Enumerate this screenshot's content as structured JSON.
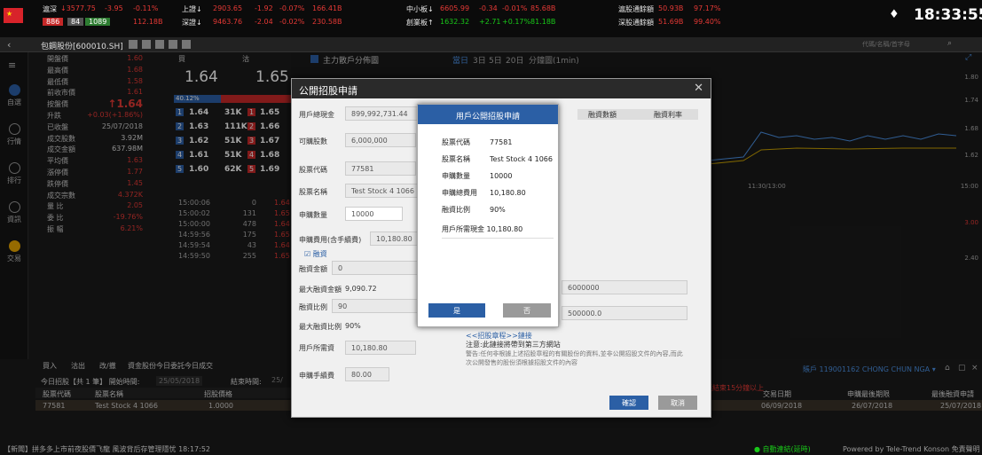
{
  "topbar": {
    "sz_name": "滬深",
    "sz_value": "↓3577.75",
    "sz_chg": "-3.95",
    "sz_pct": "-0.11%",
    "sz_up": "886",
    "sz_flat": "84",
    "sz_down": "1089",
    "sz_amt": "112.18B",
    "sh_name": "上證↓",
    "sh_value": "2903.65",
    "sh_chg": "-1.92",
    "sh_pct": "-0.07%",
    "sh_amt": "166.41B",
    "szc_name": "深證↓",
    "szc_value": "9463.76",
    "szc_chg": "-2.04",
    "szc_pct": "-0.02%",
    "szc_amt": "230.58B",
    "sme_name": "中小板↓",
    "sme_value": "6605.99",
    "sme_chg": "-0.34",
    "sme_pct": "-0.01%",
    "sme_amt": "85.68B",
    "gem_name": "創業板↑",
    "gem_value": "1632.32",
    "gem_chg": "+2.71",
    "gem_pct": "+0.17%",
    "gem_amt": "81.18B",
    "hk_sh_name": "滬股通餘額",
    "hk_sh_value": "50.93B",
    "hk_sh_pct": "97.17%",
    "hk_sz_name": "深股通餘額",
    "hk_sz_value": "51.69B",
    "hk_sz_pct": "99.40%",
    "time": "18:33:55"
  },
  "nav2": {
    "stock": "包鋼股份[600010.SH]",
    "search_placeholder": "代碼/名稱/首字母"
  },
  "leftnav": [
    {
      "label": "自選"
    },
    {
      "label": "行情"
    },
    {
      "label": "排行"
    },
    {
      "label": "資訊"
    },
    {
      "label": "交易"
    }
  ],
  "quote": {
    "rows": [
      {
        "label": "開盤價",
        "value": "1.60"
      },
      {
        "label": "最高價",
        "value": "1.68"
      },
      {
        "label": "最低價",
        "value": "1.58"
      },
      {
        "label": "前收市價",
        "value": "1.61"
      },
      {
        "label": "按盤價",
        "value": "↑1.64"
      },
      {
        "label": "升跌",
        "value": "+0.03(+1.86%)"
      },
      {
        "label": "已收盤",
        "value": "25/07/2018"
      },
      {
        "label": "成交股數",
        "value": "3.92M"
      },
      {
        "label": "成交金額",
        "value": "637.98M"
      },
      {
        "label": "平均價",
        "value": "1.63"
      },
      {
        "label": "漲停價",
        "value": "1.77"
      },
      {
        "label": "跌停價",
        "value": "1.45"
      },
      {
        "label": "成交宗數",
        "value": "4.372K"
      },
      {
        "label": "量 比",
        "value": "2.05"
      },
      {
        "label": "委 比",
        "value": "-19.76%"
      },
      {
        "label": "振 幅",
        "value": "6.21%"
      }
    ],
    "buy_label": "買",
    "sell_label": "沽",
    "buy_price": "1.64",
    "sell_price": "1.65",
    "buy_pct": "40.12%",
    "book": [
      {
        "n": "1",
        "bp": "1.64",
        "bv": "31K",
        "sn": "1",
        "sp": "1.65"
      },
      {
        "n": "2",
        "bp": "1.63",
        "bv": "111K",
        "sn": "2",
        "sp": "1.66"
      },
      {
        "n": "3",
        "bp": "1.62",
        "bv": "51K",
        "sn": "3",
        "sp": "1.67"
      },
      {
        "n": "4",
        "bp": "1.61",
        "bv": "51K",
        "sn": "4",
        "sp": "1.68"
      },
      {
        "n": "5",
        "bp": "1.60",
        "bv": "62K",
        "sn": "5",
        "sp": "1.69"
      }
    ],
    "ticks": [
      {
        "t": "15:00:06",
        "v": "0",
        "p": "1.64"
      },
      {
        "t": "15:00:02",
        "v": "131",
        "p": "1.65"
      },
      {
        "t": "15:00:00",
        "v": "478",
        "p": "1.64"
      },
      {
        "t": "14:59:56",
        "v": "175",
        "p": "1.65"
      },
      {
        "t": "14:59:54",
        "v": "43",
        "p": "1.64"
      },
      {
        "t": "14:59:50",
        "v": "255",
        "p": "1.65"
      }
    ]
  },
  "chart": {
    "tab1": "主力散戶分佈圖",
    "tab2": "當日",
    "tab3": "3日",
    "tab4": "5日",
    "tab5": "20日",
    "tab6": "分鐘圖(1min)",
    "y": [
      "1.80",
      "1.74",
      "1.68",
      "1.62",
      "15:00",
      "3.00",
      "2.40"
    ],
    "time_mid": "11:30/13:00"
  },
  "trade": {
    "tabs": [
      "買入",
      "沽出",
      "改/撤",
      "資金股份",
      "今日委託",
      "今日成交"
    ],
    "ipo_label": "今日招股【共 1 筆】 開始時間:",
    "ipo_start": "25/05/2018",
    "ipo_end_label": "結束時間:",
    "ipo_end": "25/",
    "headers": [
      "股票代碼",
      "股票名稱",
      "招股價格"
    ],
    "row": [
      "77581",
      "Test Stock 4 1066",
      "1.0000"
    ],
    "account": "賬戶 119001162 CHONG CHUN NGA ▾",
    "right_headers": [
      "交易日期",
      "申購最後期限",
      "最後融資申請"
    ],
    "right_row": [
      "06/09/2018",
      "26/07/2018",
      "25/07/2018"
    ],
    "warning": "距結束15分鐘以上"
  },
  "dialog": {
    "title": "公開招股申請",
    "f_cash_label": "用戶總現金",
    "f_cash": "899,992,731.44",
    "f_shares_label": "可購股數",
    "f_shares": "6,000,000",
    "f_code_label": "股票代碼",
    "f_code": "77581",
    "f_name_label": "股票名稱",
    "f_name": "Test Stock 4 1066",
    "f_qty_label": "申購數量",
    "f_qty": "10000",
    "f_fee_label": "申購費用(含手續費)",
    "f_fee": "10,180.80",
    "financing_label": "融資",
    "f_finamt_label": "融資金額",
    "f_finamt": "0",
    "maxfin_label": "最大融資金額",
    "maxfin": "9,090.72",
    "f_ratio_label": "融資比例",
    "f_ratio": "90",
    "maxratio_label": "最大融資比例",
    "maxratio": "90%",
    "f_need_label": "用戶所需資",
    "f_need": "10,180.80",
    "f_handfee_label": "申購手續費",
    "f_handfee": "80.00",
    "col1": "融資數額",
    "col2": "融資利率",
    "rv1": "6000000",
    "rv2": "500000.0",
    "link": "<<招股章程>>鏈接",
    "notice_title": "注意:此鏈接將帶到第三方網站",
    "notice": "警告:任何非根據上述招股章程的有關股份的資料,並非公開招股文件的內容,而此次公開發售的股份須根據招股文件的內容",
    "ok": "確認",
    "cancel": "取消"
  },
  "confirm": {
    "title": "用戶公開招股申請",
    "rows": [
      {
        "k": "股票代碼",
        "v": "77581"
      },
      {
        "k": "股票名稱",
        "v": "Test Stock 4 1066"
      },
      {
        "k": "申購數量",
        "v": "10000"
      },
      {
        "k": "申購總費用",
        "v": "10,180.80"
      },
      {
        "k": "融資比例",
        "v": "90%"
      }
    ],
    "need_label": "用戶所需現金",
    "need": "10,180.80",
    "yes": "是",
    "no": "否"
  },
  "status": {
    "news": "【新聞】拼多多上市前夜股價飞龍 風波背后存管理隱忧  18:17:52",
    "right1": "● 自動連結(延時)",
    "right2": "Powered by Tele-Trend Konson  免責聲明"
  },
  "colors": {
    "up": "#e53935",
    "down": "#19c819",
    "accent": "#2b5fa5"
  }
}
